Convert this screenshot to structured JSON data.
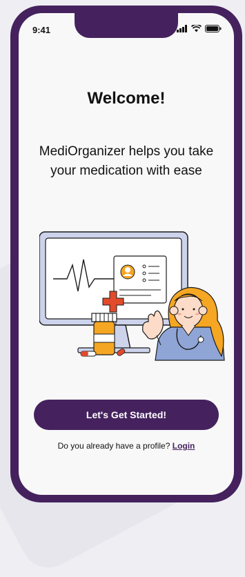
{
  "status_bar": {
    "time": "9:41"
  },
  "welcome": {
    "title": "Welcome!",
    "subtitle": "MediOrganizer helps you take your medication with ease"
  },
  "actions": {
    "primary_label": "Let's Get Started!",
    "profile_prompt": "Do you already have a profile?",
    "login_label": "Login"
  },
  "colors": {
    "brand_purple": "#45225e",
    "accent_red": "#e14a2b",
    "accent_yellow": "#f5a623"
  },
  "icons": [
    "signal-icon",
    "wifi-icon",
    "battery-icon"
  ]
}
